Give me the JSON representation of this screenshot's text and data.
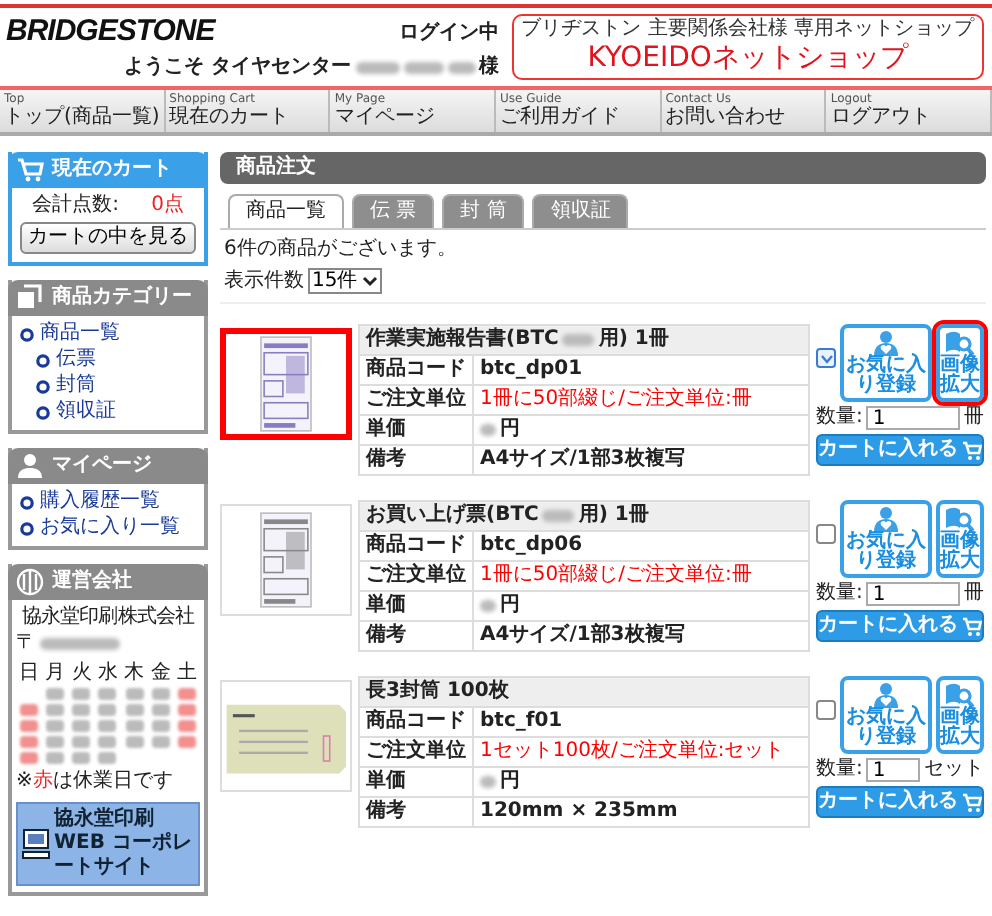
{
  "header": {
    "logo": "BRIDGESTONE",
    "login_status": "ログイン中",
    "welcome_prefix": "ようこそ タイヤセンター",
    "welcome_suffix": "様",
    "shop_subtitle": "ブリヂストン 主要関係会社様 専用ネットショップ",
    "shop_name": "KYOEIDOネットショップ"
  },
  "nav": [
    {
      "en": "Top",
      "label": "トップ(商品一覧)"
    },
    {
      "en": "Shopping Cart",
      "label": "現在のカート"
    },
    {
      "en": "My Page",
      "label": "マイページ"
    },
    {
      "en": "Use Guide",
      "label": "ご利用ガイド"
    },
    {
      "en": "Contact Us",
      "label": "お問い合わせ"
    },
    {
      "en": "Logout",
      "label": "ログアウト"
    }
  ],
  "sidebar": {
    "cart": {
      "title": "現在のカート",
      "points_label": "会計点数:",
      "points": "0点",
      "button": "カートの中を見る"
    },
    "categories": {
      "title": "商品カテゴリー",
      "items": [
        {
          "label": "商品一覧",
          "children": [
            {
              "label": "伝票"
            },
            {
              "label": "封筒"
            },
            {
              "label": "領収証"
            }
          ]
        }
      ]
    },
    "mypage": {
      "title": "マイページ",
      "items": [
        {
          "label": "購入履歴一覧"
        },
        {
          "label": "お気に入り一覧"
        }
      ]
    },
    "company": {
      "title": "運営会社",
      "name": "協永堂印刷株式会社",
      "postal": "〒",
      "calendar": {
        "weekdays": [
          "日",
          "月",
          "火",
          "水",
          "木",
          "金",
          "土"
        ],
        "weeks": [
          [
            {
              "kind": "blank"
            },
            {
              "kind": "day",
              "holiday": false
            },
            {
              "kind": "day",
              "holiday": false
            },
            {
              "kind": "day",
              "holiday": false
            },
            {
              "kind": "day",
              "holiday": false
            },
            {
              "kind": "day",
              "holiday": false
            },
            {
              "kind": "day",
              "holiday": true
            }
          ],
          [
            {
              "kind": "day",
              "holiday": true
            },
            {
              "kind": "day",
              "holiday": false
            },
            {
              "kind": "day",
              "holiday": false
            },
            {
              "kind": "day",
              "holiday": false
            },
            {
              "kind": "day",
              "holiday": false
            },
            {
              "kind": "day",
              "holiday": false
            },
            {
              "kind": "day",
              "holiday": true
            }
          ],
          [
            {
              "kind": "day",
              "holiday": true
            },
            {
              "kind": "day",
              "holiday": false
            },
            {
              "kind": "day",
              "holiday": false
            },
            {
              "kind": "day",
              "holiday": false
            },
            {
              "kind": "day",
              "holiday": false
            },
            {
              "kind": "day",
              "holiday": false
            },
            {
              "kind": "day",
              "holiday": true
            }
          ],
          [
            {
              "kind": "day",
              "holiday": true
            },
            {
              "kind": "day",
              "holiday": false
            },
            {
              "kind": "day",
              "holiday": false
            },
            {
              "kind": "day",
              "holiday": false
            },
            {
              "kind": "day",
              "holiday": false
            },
            {
              "kind": "day",
              "holiday": false
            },
            {
              "kind": "day",
              "holiday": true
            }
          ],
          [
            {
              "kind": "day",
              "holiday": true
            },
            {
              "kind": "day",
              "holiday": false
            },
            {
              "kind": "day",
              "holiday": false
            },
            {
              "kind": "day",
              "holiday": false
            },
            {
              "kind": "blank"
            },
            {
              "kind": "blank"
            },
            {
              "kind": "blank"
            }
          ]
        ]
      },
      "note_parts": [
        "※",
        "赤",
        "は休業日です"
      ],
      "banner": "協永堂印刷 WEB コーポレートサイト"
    }
  },
  "main": {
    "title": "商品注文",
    "tabs": [
      {
        "label": "商品一覧",
        "selected": true
      },
      {
        "label": "伝 票",
        "selected": false
      },
      {
        "label": "封 筒",
        "selected": false
      },
      {
        "label": "領収証",
        "selected": false
      }
    ],
    "count_text": "6件の商品がございます。",
    "per_page_label": "表示件数",
    "per_page_value": "15件",
    "products": [
      {
        "title": "作業実施報告書(BTC",
        "title_after_redaction": "用) 1冊",
        "rows": [
          {
            "label": "商品コード",
            "value": "btc_dp01",
            "kind": "plain"
          },
          {
            "label": "ご注文単位",
            "value": "1冊に50部綴じ/ご注文単位:冊",
            "kind": "alert"
          },
          {
            "label": "単価",
            "value": "円",
            "kind": "price"
          },
          {
            "label": "備考",
            "value": "A4サイズ/1部3枚複写",
            "kind": "plain"
          }
        ],
        "checked": true,
        "image_highlighted": true,
        "zoom_highlighted": true,
        "favorite_label": "お気に入り登録",
        "zoom_label": "画像拡大",
        "quantity_label": "数量:",
        "quantity": "1",
        "unit": "冊",
        "cart_button": "カートに入れる"
      },
      {
        "title": "お買い上げ票(BTC",
        "title_after_redaction": "用) 1冊",
        "rows": [
          {
            "label": "商品コード",
            "value": "btc_dp06",
            "kind": "plain"
          },
          {
            "label": "ご注文単位",
            "value": "1冊に50部綴じ/ご注文単位:冊",
            "kind": "alert"
          },
          {
            "label": "単価",
            "value": "円",
            "kind": "price"
          },
          {
            "label": "備考",
            "value": "A4サイズ/1部3枚複写",
            "kind": "plain"
          }
        ],
        "checked": false,
        "image_highlighted": false,
        "zoom_highlighted": false,
        "favorite_label": "お気に入り登録",
        "zoom_label": "画像拡大",
        "quantity_label": "数量:",
        "quantity": "1",
        "unit": "冊",
        "cart_button": "カートに入れる"
      },
      {
        "title": "長3封筒 100枚",
        "rows": [
          {
            "label": "商品コード",
            "value": "btc_f01",
            "kind": "plain"
          },
          {
            "label": "ご注文単位",
            "value": "1セット100枚/ご注文単位:セット",
            "kind": "alert"
          },
          {
            "label": "単価",
            "value": "円",
            "kind": "price"
          },
          {
            "label": "備考",
            "value": "120mm × 235mm",
            "kind": "plain"
          }
        ],
        "checked": false,
        "image_highlighted": false,
        "zoom_highlighted": false,
        "favorite_label": "お気に入り登録",
        "zoom_label": "画像拡大",
        "quantity_label": "数量:",
        "quantity": "1",
        "unit": "セット",
        "cart_button": "カートに入れる"
      }
    ]
  }
}
